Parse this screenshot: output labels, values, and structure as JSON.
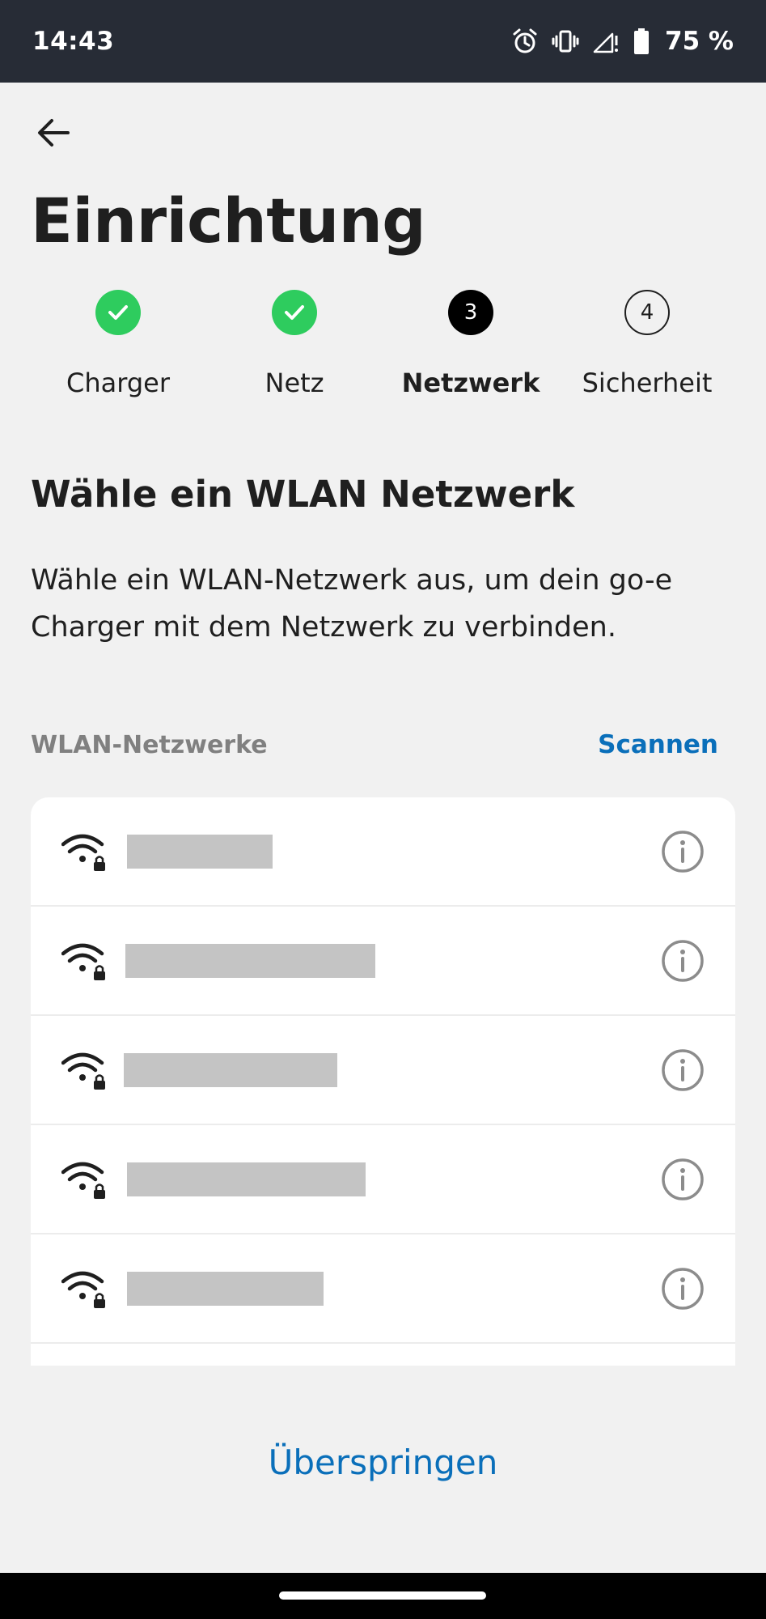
{
  "status_bar": {
    "time": "14:43",
    "battery_text": "75 %",
    "icons": [
      "alarm-icon",
      "vibrate-icon",
      "signal-icon",
      "battery-icon"
    ]
  },
  "header": {
    "back_icon": "arrow-left-icon",
    "title": "Einrichtung"
  },
  "stepper": {
    "steps": [
      {
        "label": "Charger",
        "state": "done",
        "number": ""
      },
      {
        "label": "Netz",
        "state": "done",
        "number": ""
      },
      {
        "label": "Netzwerk",
        "state": "active",
        "number": "3"
      },
      {
        "label": "Sicherheit",
        "state": "todo",
        "number": "4"
      }
    ],
    "done_color": "#2ecc5e"
  },
  "section": {
    "title": "Wähle ein WLAN Netzwerk",
    "description": "Wähle ein WLAN-Netzwerk aus, um dein go-e Charger mit dem Netzwerk zu verbinden."
  },
  "networks": {
    "header_label": "WLAN-Netzwerke",
    "scan_label": "Scannen",
    "items": [
      {
        "name": "",
        "secured": true,
        "icon": "wifi-lock-icon"
      },
      {
        "name": "",
        "secured": true,
        "icon": "wifi-lock-icon"
      },
      {
        "name": "",
        "secured": true,
        "icon": "wifi-lock-icon"
      },
      {
        "name": "",
        "secured": true,
        "icon": "wifi-lock-icon"
      },
      {
        "name": "",
        "secured": true,
        "icon": "wifi-lock-icon"
      }
    ]
  },
  "footer": {
    "skip_label": "Überspringen"
  },
  "colors": {
    "accent": "#0a6fba",
    "status_bar": "#272c36",
    "background": "#f1f1f1"
  }
}
